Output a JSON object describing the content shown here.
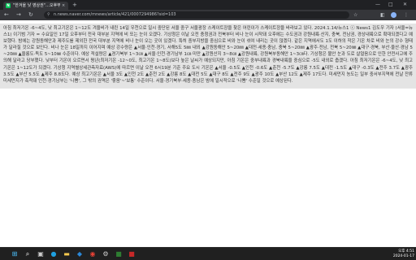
{
  "browser": {
    "tab": {
      "title": "\"한겨울 낮 영상권\"…오후부터 전국…",
      "close": "×",
      "new": "+"
    },
    "window_controls": {
      "minimize": "—",
      "maximize": "□",
      "close": "✕"
    },
    "nav": {
      "back": "←",
      "forward": "→",
      "reload": "↻"
    },
    "url": "n.news.naver.com/mnews/article/421/0007294986?sid=103",
    "toolbar_icons": {
      "bookmark": "☆",
      "extensions": "◧",
      "menu": "⋮"
    }
  },
  "article": {
    "text": "아침 최저기온 -6~4도, 낮 최고기온은 1~12도 겨울비가 내린 14일 우천으로 일시 중단된 서울 중구 서울광장 스케이트장을 찾은 어린이가 스케이트장을 바라보고 있다. 2024.1.14/뉴스1 ⓒ News1 김도우 기자 (서울=뉴스1) 이기범 기자 = 수요일인 17일 오후부터 전국 대부분 지역에 비 또는 눈이 오겠다. 기상청은 이날 오전 충청권과 전북부터 비나 눈이 시작돼 오후에는 수도권과 강원내륙·산지, 충북, 전남권, 경상내륙으로 확대되겠다고 예보했다. 밤에는 강원동해안과 제주도를 제외한 전국 대부분 지역에 비나 눈이 오는 곳이 있겠다. 특히 중부지방을 중심으로 비와 눈이 섞여 내리는 곳이 많겠다. 같은 지역에서도 1도 이하의 작은 기온 차로 비와 눈의 강수 형태가 달라질 것으로 보인다. 비나 눈은 18일까지 이어지며 예상 강수량은 ▲서울·인천·경기, 서해5도 5㎜ 내외 ▲강원동해안 5~20㎜ ▲대전·세종·충남, 충북 5~20㎜ ▲광주·전남, 전북 5~20㎜ ▲대구·경북, 부산·울산·경남 5~20㎜ ▲울릉도·독도 5~10㎜ 수준이다. 예상 적설량은 ▲경기북부 1~3㎝ ▲서울·인천·경기남부 1㎝ 미만 ▲강원산지 3~8㎝ ▲강원내륙, 강원북부동해안 1~3㎝다. 기상청은 불안 눈과 도로 살얼음으로 인한 안전사고에 주의해 달라고 당부했다. 낮부터 기온이 오르면서 평년(최저기온 -12~0도, 최고기온 1~8도)보다 높은 날씨가 예상되지만, 아침 기온은 중부내륙과 경북내륙을 중심으로 -5도 내외로 춥겠다. 아침 최저기온은 -6~4도, 낮 최고기온은 1~12도가 되겠다. 기상청 지역별상세관측자료(AWS)에 따르면 이날 오전 6시19분 기준 주요 도시 기온은 ▲서울 -0.5도 ▲인천 -0.6도 ▲춘천 -5.7도 ▲강릉 7.5도 ▲대전 -1.5도 ▲대구 -0.3도 ▲전주 3.7도 ▲광주 3.5도 ▲부산 5.5도 ▲제주 8.8도다. 예상 최고기온은 ▲서울 3도 ▲인천 2도 ▲춘천 2도 ▲강릉 8도 ▲대전 5도 ▲대구 8도 ▲전주 9도 ▲광주 10도 ▲부산 12도 ▲제주 17도다. 미세먼지 농도는 일부 중서부지역에 전날 잔류 미세먼지가 축적돼 인천·경기남부는 '나쁨', 그 밖의 권역은 '좋음'~'보통' 수준이다. 서울·경기북부·세종·충남은 밤에 일시적으로 '나쁨' 수준일 것으로 예상된다."
  },
  "taskbar": {
    "apps": [
      {
        "name": "windows-start-icon",
        "glyph": "⊞",
        "color": "#4cc2ff"
      },
      {
        "name": "search-icon",
        "glyph": "⌕",
        "color": "#ffffff"
      },
      {
        "name": "task-view-icon",
        "glyph": "▣",
        "color": "#cccccc"
      },
      {
        "name": "edge-icon",
        "glyph": "●",
        "color": "#1fa0e0"
      },
      {
        "name": "file-explorer-icon",
        "glyph": "▬",
        "color": "#f6c94e"
      },
      {
        "name": "store-icon",
        "glyph": "◆",
        "color": "#2b88d8"
      },
      {
        "name": "chrome-icon",
        "glyph": "◉",
        "color": "#e94235"
      },
      {
        "name": "settings-icon",
        "glyph": "⚙",
        "color": "#cccccc"
      },
      {
        "name": "app-icon",
        "glyph": "■",
        "color": "#2e7d32"
      },
      {
        "name": "app-icon-2",
        "glyph": "■",
        "color": "#c62828"
      }
    ],
    "time": "오후 4:51",
    "date": "2024-01-17"
  }
}
